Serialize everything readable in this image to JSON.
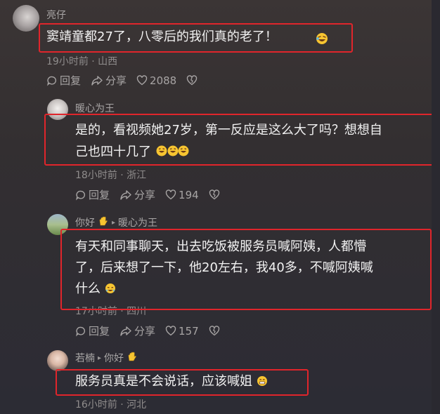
{
  "comments": [
    {
      "user": "亮仔",
      "text": "窦靖童都27了，八零后的我们真的老了！",
      "meta": "19小时前 · 山西",
      "reply_label": "回复",
      "share_label": "分享",
      "likes": "2088"
    },
    {
      "user": "暖心为王",
      "text_line1": "是的，看视频她27岁，第一反应是这么大了吗？想想自",
      "text_line2": "己也四十几了",
      "meta": "18小时前 · 浙江",
      "reply_label": "回复",
      "share_label": "分享",
      "likes": "194"
    },
    {
      "user": "你好",
      "reply_to": "暖心为王",
      "text_line1": "有天和同事聊天，出去吃饭被服务员喊阿姨，人都懵",
      "text_line2": "了，后来想了一下，他20左右，我40多，不喊阿姨喊",
      "text_line3": "什么",
      "meta": "17小时前 · 四川",
      "reply_label": "回复",
      "share_label": "分享",
      "likes": "157"
    },
    {
      "user": "若楠",
      "reply_to": "你好",
      "text": "服务员真是不会说话，应该喊姐",
      "meta": "16小时前 · 河北"
    }
  ],
  "colors": {
    "highlight": "#e0252b",
    "background": "#332f31"
  }
}
